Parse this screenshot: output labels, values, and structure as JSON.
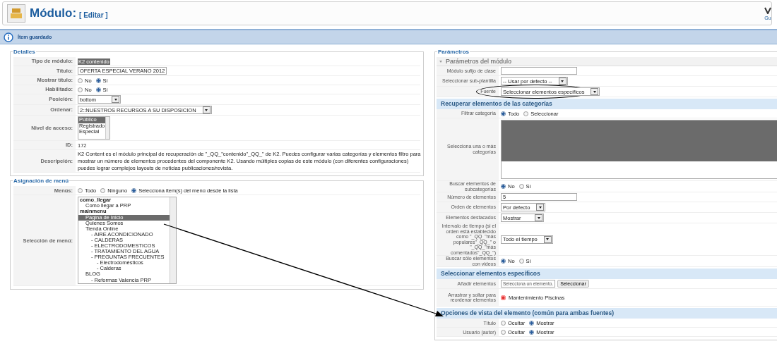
{
  "header": {
    "title": "Módulo:",
    "subtitle": "[ Editar ]",
    "toolbar_button": "Gu"
  },
  "message": "Ítem guardado",
  "columns": [
    {
      "fieldsets": [
        {
          "legend": "Detalles",
          "blocks": [
            {
              "kind": "plain",
              "rows": [
                {
                  "kind": "highlight",
                  "label": "Tipo de módulo:",
                  "value": "K2 contenido"
                },
                {
                  "kind": "text-input",
                  "label": "Título:",
                  "value": "OFERTA ESPECIAL VERANO 2012"
                },
                {
                  "kind": "radio",
                  "label": "Mostrar título:",
                  "options": [
                    {
                      "label": "No",
                      "selected": false
                    },
                    {
                      "label": "Sí",
                      "selected": true
                    }
                  ]
                },
                {
                  "kind": "radio",
                  "label": "Habilitado:",
                  "options": [
                    {
                      "label": "No",
                      "selected": false
                    },
                    {
                      "label": "Sí",
                      "selected": true
                    }
                  ]
                },
                {
                  "kind": "select",
                  "label": "Posición:",
                  "value": "bottom"
                },
                {
                  "kind": "select",
                  "label": "Ordenar:",
                  "value": "2::NUESTROS RECURSOS A SU DISPOSICION"
                },
                {
                  "kind": "listbox",
                  "label": "Nivel de acceso:",
                  "options": [
                    {
                      "label": "Público",
                      "selected": true
                    },
                    {
                      "label": "Registrado",
                      "selected": false
                    },
                    {
                      "label": "Especial",
                      "selected": false
                    }
                  ]
                },
                {
                  "kind": "text",
                  "label": "ID:",
                  "value": "172"
                },
                {
                  "kind": "paragraph",
                  "label": "Descripción:",
                  "value": "K2 Content es el módulo principal de recuperación de \"_QQ_\"contenido\"_QQ_\" de K2. Puedes configurar varias categorías y elementos filtro para mostrar un número de elementos procedentes del componente K2. Usando múltiples copias de este módulo (con diferentes configuraciones) puedes lograr complejos layouts de noticias publicaciones/revista."
                }
              ]
            }
          ]
        },
        {
          "legend": "Asignación de menú",
          "blocks": [
            {
              "kind": "plain",
              "rows": [
                {
                  "kind": "radio",
                  "label": "Menús:",
                  "options": [
                    {
                      "label": "Todo",
                      "selected": false
                    },
                    {
                      "label": "Ninguno",
                      "selected": false
                    },
                    {
                      "label": "Selecciona item(s) del menú desde la lista",
                      "selected": true
                    }
                  ]
                },
                {
                  "kind": "tree-list",
                  "label": "Selección de menú:",
                  "items": [
                    {
                      "label": "como_llegar",
                      "kind": "group",
                      "selected": false,
                      "children": [
                        {
                          "label": "Como llegar a PRP",
                          "selected": false
                        }
                      ]
                    },
                    {
                      "label": "mainmenu",
                      "kind": "group",
                      "selected": false,
                      "children": [
                        {
                          "label": "Pagina de Inicio",
                          "selected": true
                        },
                        {
                          "label": "Quienes Somos",
                          "selected": false
                        },
                        {
                          "label": "Tienda Online",
                          "selected": false,
                          "children": [
                            {
                              "label": "- AIRE ACONDICIONADO",
                              "selected": false
                            },
                            {
                              "label": "- CALDERAS",
                              "selected": false
                            },
                            {
                              "label": "- ELECTRODOMESTICOS",
                              "selected": false
                            },
                            {
                              "label": "- TRATAMIENTO DEL AGUA",
                              "selected": false
                            },
                            {
                              "label": "- PREGUNTAS FRECUENTES",
                              "selected": false,
                              "children": [
                                {
                                  "label": "- Electrodomésticos",
                                  "selected": false
                                },
                                {
                                  "label": "- Calderas",
                                  "selected": false
                                }
                              ]
                            }
                          ]
                        },
                        {
                          "label": "BLOG",
                          "selected": false,
                          "children": [
                            {
                              "label": "- Reformas Valencia PRP",
                              "selected": false
                            }
                          ]
                        }
                      ]
                    }
                  ]
                }
              ]
            }
          ]
        }
      ]
    },
    {
      "fieldsets": [
        {
          "legend": "Parámetros",
          "blocks": [
            {
              "kind": "panel",
              "title": "Parámetros del módulo",
              "expanded": true,
              "rows": [
                {
                  "kind": "text-input",
                  "label": "Módulo sufijo de clase"
                },
                {
                  "kind": "select",
                  "label": "Seleccionar sub-plantilla",
                  "value": "-- Usar por defecto --"
                },
                {
                  "kind": "select",
                  "label": "Fuente",
                  "value": "Seleccionar elementos específicos",
                  "circled": true
                }
              ]
            },
            {
              "kind": "section",
              "title": "Recuperar elementos de las categorías",
              "rows": [
                {
                  "kind": "radio",
                  "label": "Filtrar categoría",
                  "options": [
                    {
                      "label": "Todo",
                      "selected": true
                    },
                    {
                      "label": "Seleccionar",
                      "selected": false
                    }
                  ]
                },
                {
                  "kind": "category-list",
                  "label": "Selecciona una o más categorías"
                },
                {
                  "kind": "radio",
                  "label": "Buscar elementos de subcategorías",
                  "options": [
                    {
                      "label": "No",
                      "selected": true
                    },
                    {
                      "label": "Sí",
                      "selected": false
                    }
                  ]
                },
                {
                  "kind": "text-input",
                  "label": "Número de elementos",
                  "value": "5"
                },
                {
                  "kind": "select",
                  "label": "Orden de elementos",
                  "value": "Por defecto"
                },
                {
                  "kind": "select",
                  "label": "Elementos destacados",
                  "value": "Mostrar"
                },
                {
                  "kind": "select",
                  "label": "Intervalo de tiempo (si el orden está establecido como \"_QQ_\"más populares\"_QQ_\" o \"_QQ_\"más comentados\"_QQ_\")",
                  "value": "Todo el tiempo"
                },
                {
                  "kind": "radio",
                  "label": "Buscar sólo elementos con videos",
                  "options": [
                    {
                      "label": "No",
                      "selected": true
                    },
                    {
                      "label": "Sí",
                      "selected": false
                    }
                  ]
                }
              ]
            },
            {
              "kind": "section",
              "title": "Seleccionar elementos específicos",
              "rows": [
                {
                  "kind": "picker",
                  "label": "Añadir elementos",
                  "value": "Selecciona un elemento.",
                  "button": "Seleccionar"
                },
                {
                  "kind": "sortable",
                  "label": "Arrastrar y soltar para reordenar elementos",
                  "items": [
                    {
                      "label": "Mantenimiento Piscinas"
                    }
                  ]
                }
              ]
            },
            {
              "kind": "section",
              "title": "Opciones de vista del elemento (común para ambas fuentes)",
              "rows": [
                {
                  "kind": "radio",
                  "label": "Título",
                  "options": [
                    {
                      "label": "Ocultar",
                      "selected": false
                    },
                    {
                      "label": "Mostrar",
                      "selected": true
                    }
                  ]
                },
                {
                  "kind": "radio",
                  "label": "Usuario (autor)",
                  "options": [
                    {
                      "label": "Ocultar",
                      "selected": false
                    },
                    {
                      "label": "Mostrar",
                      "selected": true
                    }
                  ]
                }
              ]
            }
          ]
        }
      ]
    }
  ]
}
